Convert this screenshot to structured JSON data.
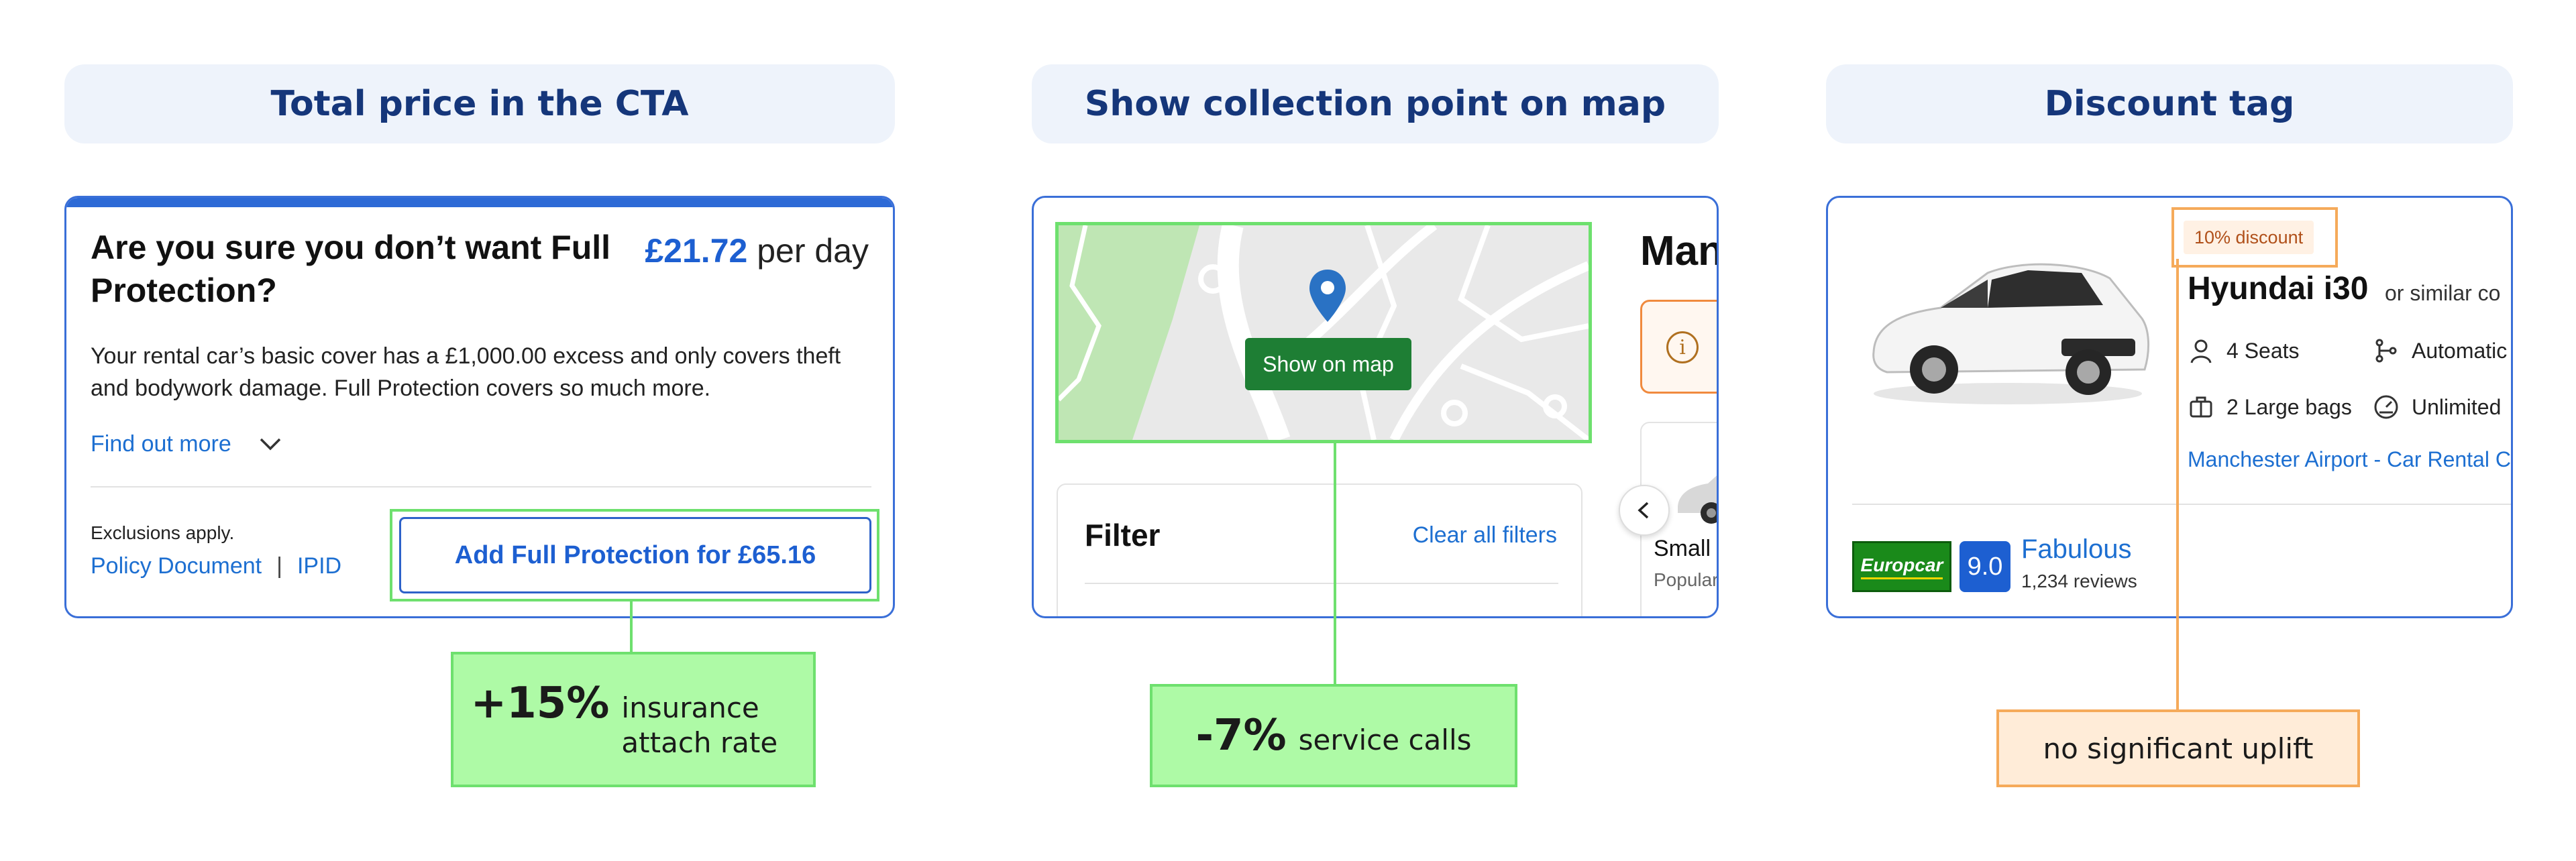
{
  "sections": [
    {
      "header": "Total price in the CTA",
      "card": {
        "question": "Are you sure you don’t want Full Protection?",
        "price_amount": "£21.72",
        "price_suffix": "per day",
        "description": "Your rental car’s basic cover has a £1,000.00 excess and only covers theft and bodywork damage. Full Protection covers so much more.",
        "find_out_more": "Find out more",
        "exclusions": "Exclusions apply.",
        "policy_link": "Policy Document",
        "separator": "|",
        "ipid_link": "IPID",
        "cta_label": "Add Full Protection for £65.16"
      },
      "result": {
        "big": "+15%",
        "small": "insurance attach rate",
        "tone": "positive"
      }
    },
    {
      "header": "Show collection point on map",
      "card": {
        "map_button": "Show on map",
        "filter_title": "Filter",
        "clear_filters": "Clear all filters",
        "heading_partial": "Man",
        "car_size_label": "Small",
        "car_size_sub": "Popular"
      },
      "result": {
        "big": "-7%",
        "small": "service calls",
        "tone": "positive"
      }
    },
    {
      "header": "Discount tag",
      "card": {
        "discount_badge": "10% discount",
        "model": "Hyundai i30",
        "similar": "or similar co",
        "seats": "4 Seats",
        "transmission": "Automatic",
        "bags": "2 Large bags",
        "mileage": "Unlimited",
        "location": "Manchester Airport - Car Rental C",
        "supplier": "Europcar",
        "score": "9.0",
        "rating_word": "Fabulous",
        "reviews": "1,234 reviews"
      },
      "result": {
        "big": "",
        "small": "no significant uplift",
        "tone": "neutral"
      }
    }
  ],
  "colors": {
    "header_bg": "#eef3fb",
    "header_text": "#15367a",
    "card_border": "#3a6fd8",
    "link_blue": "#1d6fd1",
    "positive_bg": "#aefaa6",
    "positive_border": "#6ee06e",
    "neutral_bg": "#ffecd8",
    "neutral_border": "#f5aa5a",
    "map_button_bg": "#1e7e34",
    "pin_blue": "#2a72c4"
  }
}
